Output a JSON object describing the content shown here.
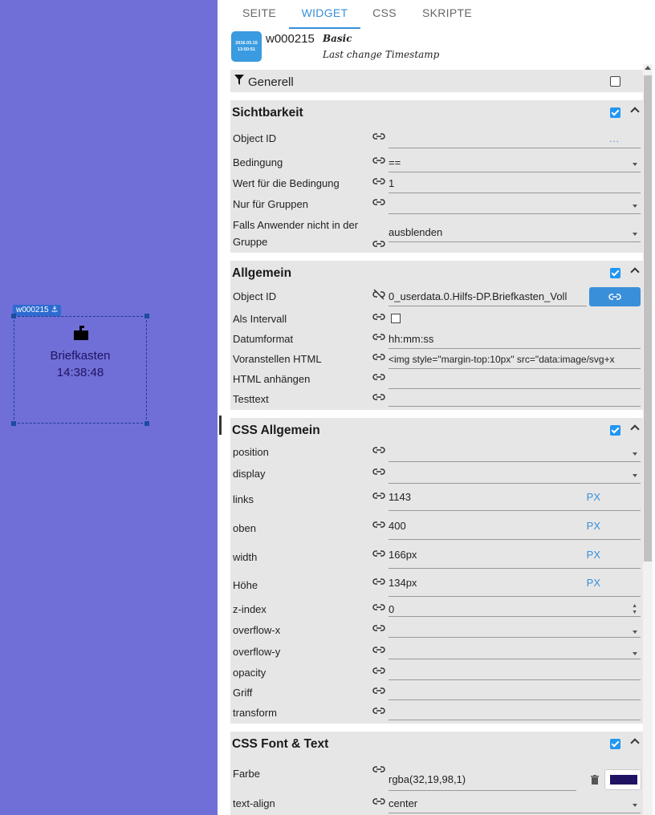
{
  "canvas": {
    "widget_tag": "w000215 ⚓",
    "widget_name": "Briefkasten",
    "widget_time": "14:38:48",
    "background_color": "#6f6fd7",
    "text_color": "#201362"
  },
  "tabs": [
    "SEITE",
    "WIDGET",
    "CSS",
    "SKRIPTE"
  ],
  "active_tab": "WIDGET",
  "widget_info": {
    "thumb_text": "2016.03.15\n13:50:51",
    "id": "w000215",
    "set": "Basic",
    "description": "Last change Timestamp"
  },
  "generell": {
    "title": "Generell"
  },
  "sichtbarkeit": {
    "title": "Sichtbarkeit",
    "rows": [
      {
        "label": "Object ID",
        "value": "",
        "extra": "..."
      },
      {
        "label": "Bedingung",
        "value": "=="
      },
      {
        "label": "Wert für die Bedingung",
        "value": "1"
      },
      {
        "label": "Nur für Gruppen",
        "value": ""
      },
      {
        "label": "Falls Anwender nicht in der",
        "label2": "Gruppe",
        "value": "ausblenden"
      }
    ]
  },
  "allgemein": {
    "title": "Allgemein",
    "rows": [
      {
        "label": "Object ID",
        "value": "0_userdata.0.Hilfs-DP.Briefkasten_Voll"
      },
      {
        "label": "Als Intervall",
        "value": ""
      },
      {
        "label": "Datumformat",
        "value": "hh:mm:ss"
      },
      {
        "label": "Voranstellen HTML",
        "value": "<img style=\"margin-top:10px\" src=\"data:image/svg+x"
      },
      {
        "label": "HTML anhängen",
        "value": ""
      },
      {
        "label": "Testtext",
        "value": ""
      }
    ]
  },
  "css_allgemein": {
    "title": "CSS Allgemein",
    "rows": [
      {
        "label": "position",
        "value": ""
      },
      {
        "label": "display",
        "value": ""
      },
      {
        "label": "links",
        "value": "1143",
        "unit": "PX"
      },
      {
        "label": "oben",
        "value": "400",
        "unit": "PX"
      },
      {
        "label": "width",
        "value": "166px",
        "unit": "PX"
      },
      {
        "label": "Höhe",
        "value": "134px",
        "unit": "PX"
      },
      {
        "label": "z-index",
        "value": "0"
      },
      {
        "label": "overflow-x",
        "value": ""
      },
      {
        "label": "overflow-y",
        "value": ""
      },
      {
        "label": "opacity",
        "value": ""
      },
      {
        "label": "Griff",
        "value": ""
      },
      {
        "label": "transform",
        "value": ""
      }
    ]
  },
  "css_font": {
    "title": "CSS Font & Text",
    "rows": [
      {
        "label": "Farbe",
        "value": "rgba(32,19,98,1)",
        "color": "#201362"
      },
      {
        "label": "text-align",
        "value": "center"
      }
    ]
  },
  "colors": {
    "accent": "#3a8fd9",
    "group_bg": "#e6e6e6",
    "checkbox": "#2196f3"
  }
}
